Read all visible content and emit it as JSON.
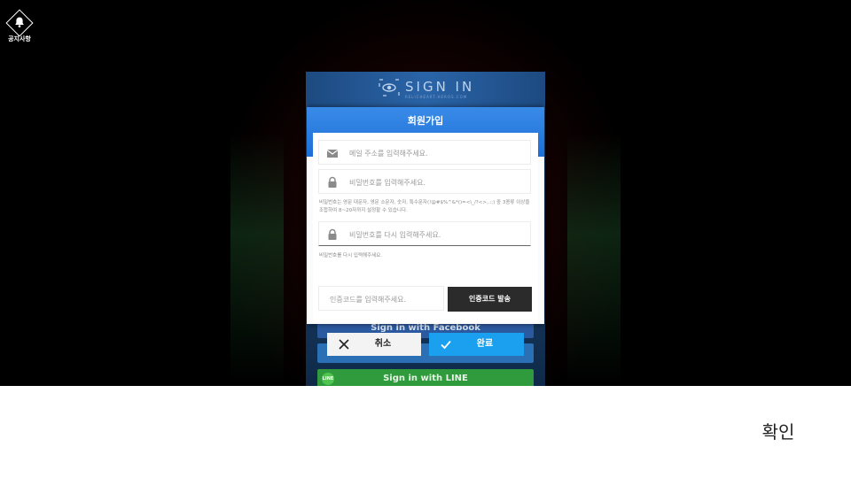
{
  "notice": {
    "label": "공지사항",
    "icon": "bell-icon"
  },
  "signin": {
    "title": "SIGN IN",
    "subtitle": "RELICHEART.HEROS.COM",
    "facebook_label": "Sign in with Facebook",
    "line_label": "Sign in with LINE",
    "line_badge": "LINE"
  },
  "modal": {
    "title": "회원가입",
    "email_placeholder": "메일 주소를 입력해주세요.",
    "password_placeholder": "비밀번호를 입력해주세요.",
    "password_hint": "비밀번호는 영문 대문자, 영문 소문자, 숫자, 특수문자(!@#$%^&*()=<\\_/?<>,.:;) 중 3종류 이상을 조합하여 8~20자까지 설정할 수 있습니다.",
    "password_confirm_placeholder": "비밀번호를 다시 입력해주세요.",
    "password_confirm_hint": "비밀번호를 다시 입력해주세요.",
    "code_placeholder": "인증코드를 입력해주세요.",
    "send_code_label": "인증코드 발송",
    "cancel_label": "취소",
    "done_label": "완료"
  },
  "bottom": {
    "confirm_label": "확인"
  },
  "colors": {
    "header_blue": "#1c6fd6",
    "done_blue": "#1aa0ee",
    "send_dark": "#2b2b2b"
  }
}
